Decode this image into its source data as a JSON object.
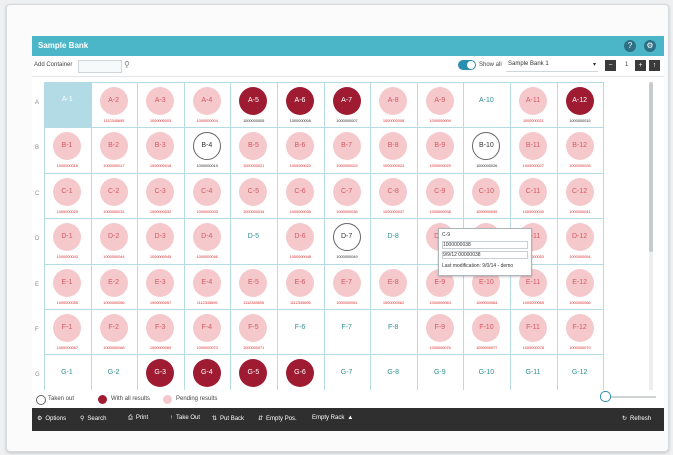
{
  "window": {
    "title": "Sample Bank"
  },
  "toolbar": {
    "add_container_label": "Add Container",
    "show_all_label": "Show all",
    "sample_bank_select": "Sample Bank 1",
    "page_number": "1"
  },
  "rows": [
    {
      "label": "A",
      "cells": [
        {
          "id": "A-1",
          "status": "selected",
          "barcode": ""
        },
        {
          "id": "A-2",
          "status": "pending",
          "barcode": "1112345695"
        },
        {
          "id": "A-3",
          "status": "pending",
          "barcode": "1000000003"
        },
        {
          "id": "A-4",
          "status": "pending",
          "barcode": "1000000004"
        },
        {
          "id": "A-5",
          "status": "all",
          "barcode": "1000000005"
        },
        {
          "id": "A-6",
          "status": "all",
          "barcode": "1000000006"
        },
        {
          "id": "A-7",
          "status": "all",
          "barcode": "1000000007"
        },
        {
          "id": "A-8",
          "status": "pending",
          "barcode": "1000000008"
        },
        {
          "id": "A-9",
          "status": "pending",
          "barcode": "1000000009"
        },
        {
          "id": "A-10",
          "status": "empty",
          "barcode": ""
        },
        {
          "id": "A-11",
          "status": "pending",
          "barcode": "1000000011"
        },
        {
          "id": "A-12",
          "status": "all",
          "barcode": "1000000015"
        }
      ]
    },
    {
      "label": "B",
      "cells": [
        {
          "id": "B-1",
          "status": "pending",
          "barcode": "1000000016"
        },
        {
          "id": "B-2",
          "status": "pending",
          "barcode": "1000000017"
        },
        {
          "id": "B-3",
          "status": "pending",
          "barcode": "1000000018"
        },
        {
          "id": "B-4",
          "status": "taken",
          "barcode": "1000000019"
        },
        {
          "id": "B-5",
          "status": "pending",
          "barcode": "1000000021"
        },
        {
          "id": "B-6",
          "status": "pending",
          "barcode": "1000000022"
        },
        {
          "id": "B-7",
          "status": "pending",
          "barcode": "1000000023"
        },
        {
          "id": "B-8",
          "status": "pending",
          "barcode": "1000000024"
        },
        {
          "id": "B-9",
          "status": "pending",
          "barcode": "1000000025"
        },
        {
          "id": "B-10",
          "status": "taken",
          "barcode": "1000000026"
        },
        {
          "id": "B-11",
          "status": "pending",
          "barcode": "1000000027"
        },
        {
          "id": "B-12",
          "status": "pending",
          "barcode": "1000000028"
        }
      ]
    },
    {
      "label": "C",
      "cells": [
        {
          "id": "C-1",
          "status": "pending",
          "barcode": "1000000029"
        },
        {
          "id": "C-2",
          "status": "pending",
          "barcode": "1000000031"
        },
        {
          "id": "C-3",
          "status": "pending",
          "barcode": "1000000032"
        },
        {
          "id": "C-4",
          "status": "pending",
          "barcode": "1000000033"
        },
        {
          "id": "C-5",
          "status": "pending",
          "barcode": "1000000034"
        },
        {
          "id": "C-6",
          "status": "pending",
          "barcode": "1000000035"
        },
        {
          "id": "C-7",
          "status": "pending",
          "barcode": "1000000036"
        },
        {
          "id": "C-8",
          "status": "pending",
          "barcode": "1000000037"
        },
        {
          "id": "C-9",
          "status": "pending",
          "barcode": "1000000038"
        },
        {
          "id": "C-10",
          "status": "pending",
          "barcode": "1000000039"
        },
        {
          "id": "C-11",
          "status": "pending",
          "barcode": "1000000040"
        },
        {
          "id": "C-12",
          "status": "pending",
          "barcode": "1000000041"
        }
      ]
    },
    {
      "label": "D",
      "cells": [
        {
          "id": "D-1",
          "status": "pending",
          "barcode": "1000000043"
        },
        {
          "id": "D-2",
          "status": "pending",
          "barcode": "1000000044"
        },
        {
          "id": "D-3",
          "status": "pending",
          "barcode": "1000000045"
        },
        {
          "id": "D-4",
          "status": "pending",
          "barcode": "1000000046"
        },
        {
          "id": "D-5",
          "status": "empty",
          "barcode": ""
        },
        {
          "id": "D-6",
          "status": "pending",
          "barcode": "1000000048"
        },
        {
          "id": "D-7",
          "status": "taken",
          "barcode": "1000000049"
        },
        {
          "id": "D-8",
          "status": "empty",
          "barcode": ""
        },
        {
          "id": "D-9",
          "status": "pending",
          "barcode": ""
        },
        {
          "id": "D-10",
          "status": "pending",
          "barcode": ""
        },
        {
          "id": "D-11",
          "status": "pending",
          "barcode": "1000000053"
        },
        {
          "id": "D-12",
          "status": "pending",
          "barcode": "1000000054"
        }
      ]
    },
    {
      "label": "E",
      "cells": [
        {
          "id": "E-1",
          "status": "pending",
          "barcode": "1000000055"
        },
        {
          "id": "E-2",
          "status": "pending",
          "barcode": "1000000056"
        },
        {
          "id": "E-3",
          "status": "pending",
          "barcode": "1000000057"
        },
        {
          "id": "E-4",
          "status": "pending",
          "barcode": "1112345695"
        },
        {
          "id": "E-5",
          "status": "pending",
          "barcode": "1112345695"
        },
        {
          "id": "E-6",
          "status": "pending",
          "barcode": "1112345695"
        },
        {
          "id": "E-7",
          "status": "pending",
          "barcode": "1000000061"
        },
        {
          "id": "E-8",
          "status": "pending",
          "barcode": "1000000062"
        },
        {
          "id": "E-9",
          "status": "pending",
          "barcode": "1000000063"
        },
        {
          "id": "E-10",
          "status": "pending",
          "barcode": "1000000064"
        },
        {
          "id": "E-11",
          "status": "pending",
          "barcode": "1000000065"
        },
        {
          "id": "E-12",
          "status": "pending",
          "barcode": "1000000066"
        }
      ]
    },
    {
      "label": "F",
      "cells": [
        {
          "id": "F-1",
          "status": "pending",
          "barcode": "1000000067"
        },
        {
          "id": "F-2",
          "status": "pending",
          "barcode": "1000000068"
        },
        {
          "id": "F-3",
          "status": "pending",
          "barcode": "1000000069"
        },
        {
          "id": "F-4",
          "status": "pending",
          "barcode": "1000000070"
        },
        {
          "id": "F-5",
          "status": "pending",
          "barcode": "1000000071"
        },
        {
          "id": "F-6",
          "status": "empty",
          "barcode": ""
        },
        {
          "id": "F-7",
          "status": "empty",
          "barcode": ""
        },
        {
          "id": "F-8",
          "status": "empty",
          "barcode": ""
        },
        {
          "id": "F-9",
          "status": "pending",
          "barcode": "1000000076"
        },
        {
          "id": "F-10",
          "status": "pending",
          "barcode": "1000000077"
        },
        {
          "id": "F-11",
          "status": "pending",
          "barcode": "1000000078"
        },
        {
          "id": "F-12",
          "status": "pending",
          "barcode": "1000000079"
        }
      ]
    },
    {
      "label": "G",
      "cells": [
        {
          "id": "G-1",
          "status": "empty",
          "barcode": ""
        },
        {
          "id": "G-2",
          "status": "empty",
          "barcode": ""
        },
        {
          "id": "G-3",
          "status": "all",
          "barcode": ""
        },
        {
          "id": "G-4",
          "status": "all",
          "barcode": ""
        },
        {
          "id": "G-5",
          "status": "all",
          "barcode": ""
        },
        {
          "id": "G-6",
          "status": "all",
          "barcode": ""
        },
        {
          "id": "G-7",
          "status": "empty",
          "barcode": ""
        },
        {
          "id": "G-8",
          "status": "empty",
          "barcode": ""
        },
        {
          "id": "G-9",
          "status": "empty",
          "barcode": ""
        },
        {
          "id": "G-10",
          "status": "empty",
          "barcode": ""
        },
        {
          "id": "G-11",
          "status": "empty",
          "barcode": ""
        },
        {
          "id": "G-12",
          "status": "empty",
          "barcode": ""
        }
      ]
    }
  ],
  "tooltip": {
    "position": "C-9",
    "barcode": "1000000038",
    "id_line": "9/9/12 00000038",
    "last_modification": "Last modification: 9/0/14 - demo"
  },
  "legend": {
    "taken_out": "Taken out",
    "with_all_results": "With all results",
    "pending_results": "Pending results"
  },
  "bottom": {
    "options": "Options",
    "search": "Search",
    "print": "Print",
    "take_out": "Take Out",
    "put_back": "Put Back",
    "empty_pos": "Empty Pos.",
    "empty_rack": "Empty Rack",
    "refresh": "Refresh"
  },
  "colors": {
    "header": "#4bb6c8",
    "pending": "#f5c8cb",
    "all_results": "#9e1b32",
    "bottom_bar": "#2f2f2f"
  }
}
